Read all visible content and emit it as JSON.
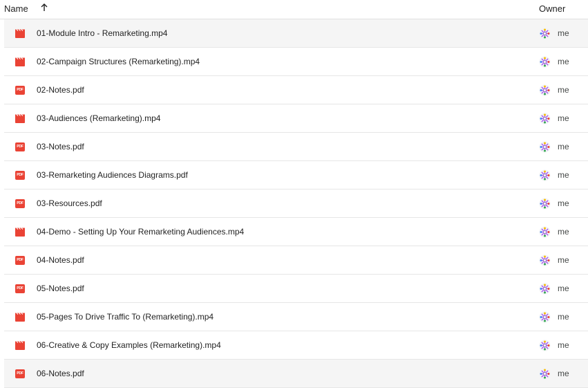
{
  "header": {
    "name_label": "Name",
    "owner_label": "Owner",
    "sort_direction": "ascending"
  },
  "colors": {
    "file_icon_red": "#ea4335",
    "row_shade": "#f5f5f5"
  },
  "files": [
    {
      "name": "01-Module Intro - Remarketing.mp4",
      "type": "video",
      "owner": "me",
      "shaded": true
    },
    {
      "name": "02-Campaign Structures (Remarketing).mp4",
      "type": "video",
      "owner": "me",
      "shaded": false
    },
    {
      "name": "02-Notes.pdf",
      "type": "pdf",
      "owner": "me",
      "shaded": false
    },
    {
      "name": "03-Audiences (Remarketing).mp4",
      "type": "video",
      "owner": "me",
      "shaded": false
    },
    {
      "name": "03-Notes.pdf",
      "type": "pdf",
      "owner": "me",
      "shaded": false
    },
    {
      "name": "03-Remarketing Audiences Diagrams.pdf",
      "type": "pdf",
      "owner": "me",
      "shaded": false
    },
    {
      "name": "03-Resources.pdf",
      "type": "pdf",
      "owner": "me",
      "shaded": false
    },
    {
      "name": "04-Demo - Setting Up Your Remarketing Audiences.mp4",
      "type": "video",
      "owner": "me",
      "shaded": false
    },
    {
      "name": "04-Notes.pdf",
      "type": "pdf",
      "owner": "me",
      "shaded": false
    },
    {
      "name": "05-Notes.pdf",
      "type": "pdf",
      "owner": "me",
      "shaded": false
    },
    {
      "name": "05-Pages To Drive Traffic To (Remarketing).mp4",
      "type": "video",
      "owner": "me",
      "shaded": false
    },
    {
      "name": "06-Creative & Copy Examples (Remarketing).mp4",
      "type": "video",
      "owner": "me",
      "shaded": false
    },
    {
      "name": "06-Notes.pdf",
      "type": "pdf",
      "owner": "me",
      "shaded": true
    }
  ],
  "icons": {
    "video": "video-file-icon",
    "pdf": "pdf-file-icon",
    "sort": "arrow-up-icon",
    "owner": "owner-avatar-icon"
  },
  "pdf_badge_text": "PDF"
}
